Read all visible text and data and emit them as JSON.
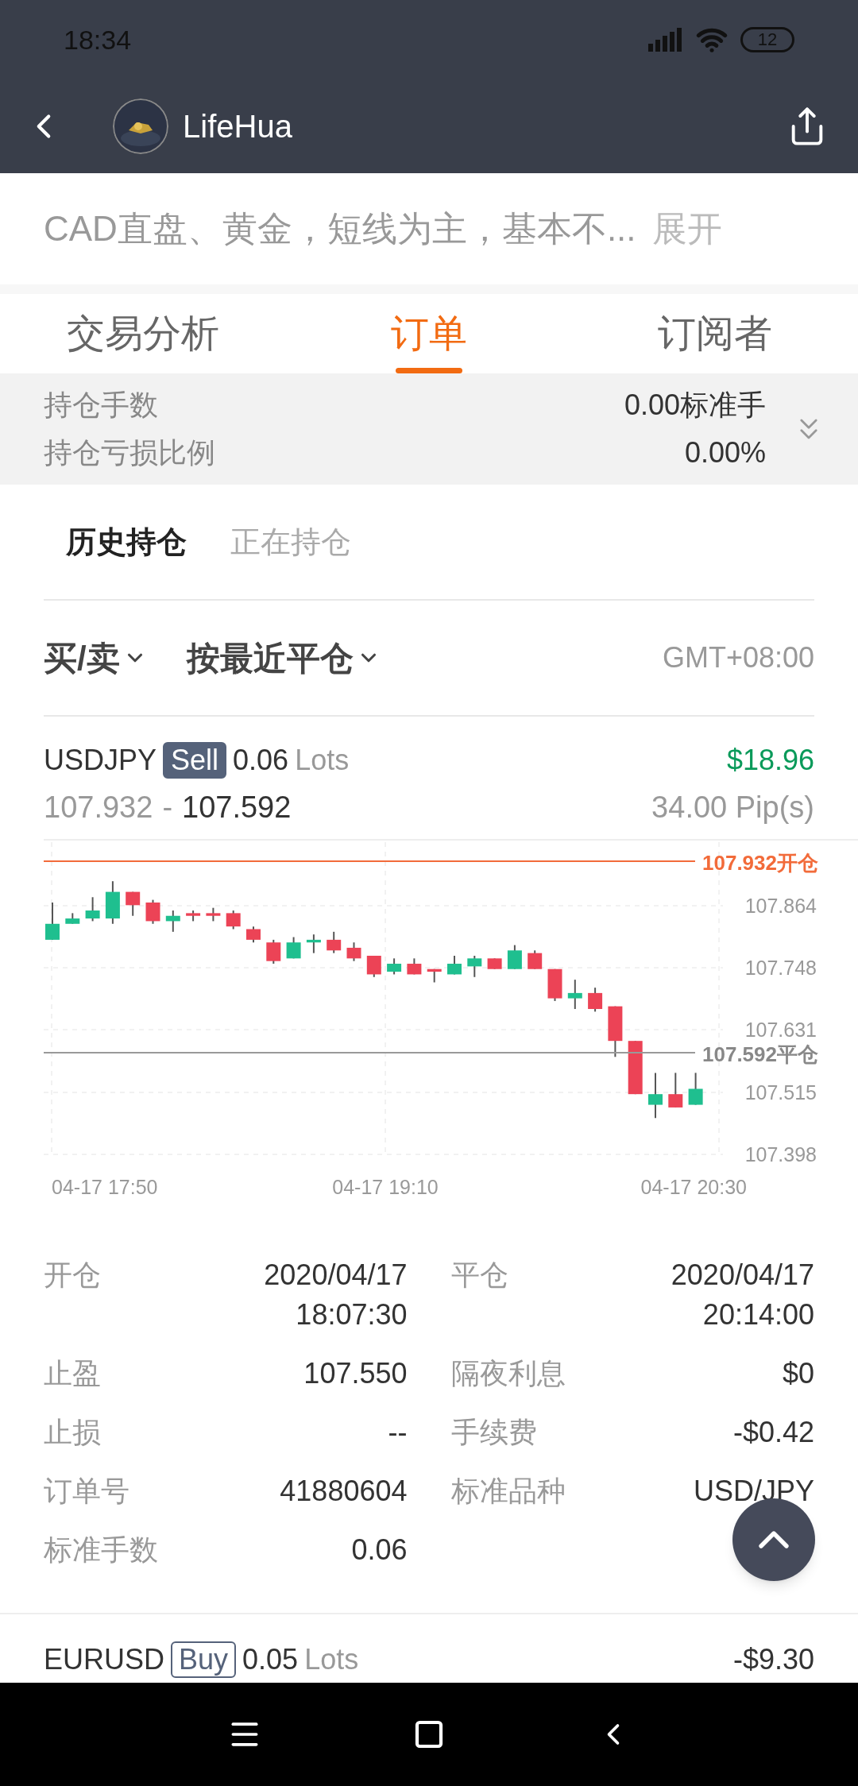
{
  "status_bar": {
    "time": "18:34",
    "battery": "12"
  },
  "header": {
    "title": "LifeHua"
  },
  "strategy": {
    "text": "CAD直盘、黄金，短线为主，基本不...",
    "expand": "展开"
  },
  "tabs": [
    {
      "label": "交易分析",
      "selected": false
    },
    {
      "label": "订单",
      "selected": true
    },
    {
      "label": "订阅者",
      "selected": false
    }
  ],
  "summary": [
    {
      "label": "持仓手数",
      "value": "0.00标准手"
    },
    {
      "label": "持仓亏损比例",
      "value": "0.00%"
    }
  ],
  "subtabs": [
    {
      "label": "历史持仓",
      "selected": true
    },
    {
      "label": "正在持仓",
      "selected": false
    }
  ],
  "filters": [
    {
      "label": "买/卖"
    },
    {
      "label": "按最近平仓"
    }
  ],
  "timezone": "GMT+08:00",
  "orders": [
    {
      "symbol": "USDJPY",
      "side": "Sell",
      "kind": "sell",
      "lots": "0.06",
      "lots_unit": "Lots",
      "profit": "$18.96",
      "positive": true,
      "open_price": "107.932",
      "separator": "-",
      "close_price": "107.592",
      "pips": "34.00 Pip(s)",
      "chart": {
        "open_label": "107.932开仓",
        "close_label": "107.592平仓",
        "yticks": [
          "107.864",
          "107.748",
          "107.631",
          "107.515",
          "107.398"
        ],
        "xticks": [
          "04-17 17:50",
          "04-17 19:10",
          "04-17 20:30"
        ]
      },
      "details_left": [
        {
          "label": "开仓",
          "lines": [
            "2020/04/17",
            "18:07:30"
          ]
        },
        {
          "label": "止盈",
          "lines": [
            "107.550"
          ]
        },
        {
          "label": "止损",
          "lines": [
            "--"
          ]
        },
        {
          "label": "订单号",
          "lines": [
            "41880604"
          ]
        },
        {
          "label": "标准手数",
          "lines": [
            "0.06"
          ]
        }
      ],
      "details_right": [
        {
          "label": "平仓",
          "lines": [
            "2020/04/17",
            "20:14:00"
          ]
        },
        {
          "label": "隔夜利息",
          "lines": [
            "$0"
          ]
        },
        {
          "label": "手续费",
          "lines": [
            "-$0.42"
          ]
        },
        {
          "label": "标准品种",
          "lines": [
            "USD/JPY"
          ]
        }
      ]
    },
    {
      "symbol": "EURUSD",
      "side": "Buy",
      "kind": "buy",
      "lots": "0.05",
      "lots_unit": "Lots",
      "profit": "-$9.30",
      "positive": false
    }
  ]
}
